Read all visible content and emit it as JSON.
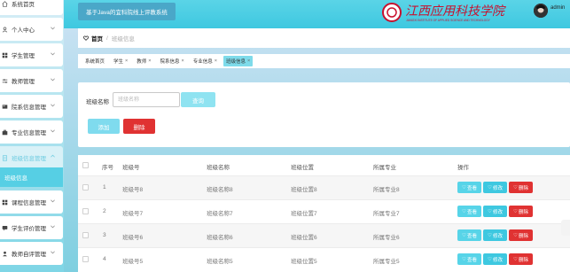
{
  "sidebar": {
    "items": [
      {
        "label": "系统首页",
        "icon": "home-icon",
        "expandable": false
      },
      {
        "label": "个人中心",
        "icon": "user-icon",
        "expandable": true
      },
      {
        "label": "学生管理",
        "icon": "grid-icon",
        "expandable": true
      },
      {
        "label": "教师管理",
        "icon": "sliders-icon",
        "expandable": true
      },
      {
        "label": "院系信息管理",
        "icon": "card-icon",
        "expandable": true
      },
      {
        "label": "专业信息管理",
        "icon": "briefcase-icon",
        "expandable": true
      },
      {
        "label": "班级信息管理",
        "icon": "doc-icon",
        "expandable": true,
        "open": true
      },
      {
        "label": "课程信息管理",
        "icon": "grid-icon",
        "expandable": true
      },
      {
        "label": "学生评价管理",
        "icon": "chat-icon",
        "expandable": true
      },
      {
        "label": "教师自评管理",
        "icon": "user-icon",
        "expandable": true
      }
    ],
    "active_sub": "班级信息"
  },
  "header": {
    "system_title": "基于Java的宜科院线上评教系统",
    "logo_cn": "江西应用科技学院",
    "logo_en": "JIANGXI INSTITUTE OF APPLIED SCIENCE AND TECHNOLOGY",
    "username": "admin"
  },
  "breadcrumb": {
    "home": "首页",
    "separator": "/",
    "current": "班级信息"
  },
  "tags": [
    {
      "label": "系统首页",
      "closable": false,
      "active": false
    },
    {
      "label": "学生",
      "closable": true,
      "active": false
    },
    {
      "label": "教师",
      "closable": true,
      "active": false
    },
    {
      "label": "院系信息",
      "closable": true,
      "active": false
    },
    {
      "label": "专业信息",
      "closable": true,
      "active": false
    },
    {
      "label": "班级信息",
      "closable": true,
      "active": true
    }
  ],
  "search": {
    "label": "班级名称",
    "placeholder": "班级名称",
    "query_button": "查询",
    "add_button": "添加",
    "delete_button": "删除"
  },
  "table": {
    "headers": [
      "序号",
      "班级号",
      "班级名称",
      "班级位置",
      "所属专业",
      "操作"
    ],
    "rows": [
      {
        "index": "1",
        "code": "班级号8",
        "name": "班级名称8",
        "location": "班级位置8",
        "major": "所属专业8"
      },
      {
        "index": "2",
        "code": "班级号7",
        "name": "班级名称7",
        "location": "班级位置7",
        "major": "所属专业7"
      },
      {
        "index": "3",
        "code": "班级号6",
        "name": "班级名称6",
        "location": "班级位置6",
        "major": "所属专业6"
      },
      {
        "index": "4",
        "code": "班级号5",
        "name": "班级名称5",
        "location": "班级位置5",
        "major": "所属专业5"
      }
    ],
    "actions": {
      "view": "查看",
      "edit": "修改",
      "delete": "删除"
    }
  },
  "colors": {
    "accent": "#3ec8e0",
    "danger": "#e03232",
    "logo_red": "#c8102e"
  }
}
